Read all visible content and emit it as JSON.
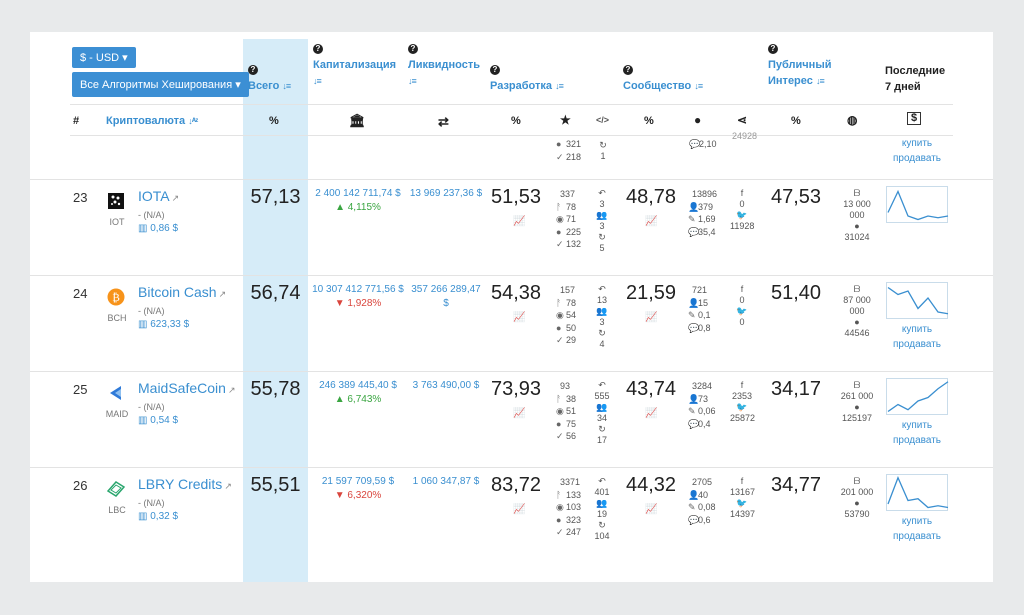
{
  "controls": {
    "currency": "$ - USD",
    "algorithms": "Все Алгоритмы Хеширования"
  },
  "headers": {
    "total": "Всего",
    "capitalization": "Капитализация",
    "liquidity": "Ликвидность",
    "development": "Разработка",
    "community": "Сообщество",
    "public_interest_1": "Публичный",
    "public_interest_2": "Интерес",
    "last7_1": "Последние",
    "last7_2": "7 дней"
  },
  "subheaders": {
    "hash": "#",
    "crypto": "Криптовалюта",
    "total_pct": "%",
    "dev_pct": "%",
    "comm_pct": "%",
    "interest_pct": "%"
  },
  "partial_top": {
    "dev_stats": [
      "321",
      "218"
    ],
    "fork_stats": [
      "1"
    ],
    "comment": "2,10",
    "interest_partial": "24928",
    "links": [
      "купить",
      "продавать"
    ]
  },
  "rows": [
    {
      "rank": "23",
      "name": "IOTA",
      "symbol": "IOT",
      "na": "- (N/A)",
      "price": "0,86 $",
      "total": "57,13",
      "cap": "2 400 142 711,74 $",
      "cap_change": "4,115%",
      "cap_dir": "up",
      "liquidity": "13 969 237,36 $",
      "dev": "51,53",
      "dev_stats": [
        "337",
        "78",
        "71",
        "225",
        "132"
      ],
      "forks": [
        "3",
        "3",
        "5"
      ],
      "community": "48,78",
      "comm_stats": [
        "13896",
        "379",
        "1,69",
        "35,4"
      ],
      "social": [
        "0",
        "11928"
      ],
      "interest": "47,53",
      "interest_stats": [
        "13 000",
        "000",
        "31024"
      ],
      "spark": [
        0.3,
        0.9,
        0.2,
        0.1,
        0.2,
        0.15,
        0.2
      ],
      "links": []
    },
    {
      "rank": "24",
      "name": "Bitcoin Cash",
      "symbol": "BCH",
      "na": "- (N/A)",
      "price": "623,33 $",
      "total": "56,74",
      "cap": "10 307 412 771,56 $",
      "cap_change": "1,928%",
      "cap_dir": "down",
      "liquidity": "357 266 289,47 $",
      "dev": "54,38",
      "dev_stats": [
        "157",
        "78",
        "54",
        "50",
        "29"
      ],
      "forks": [
        "13",
        "3",
        "4"
      ],
      "community": "21,59",
      "comm_stats": [
        "721",
        "15",
        "0,1",
        "0,8"
      ],
      "social": [
        "0",
        "0"
      ],
      "interest": "51,40",
      "interest_stats": [
        "87 000",
        "000",
        "44546"
      ],
      "spark": [
        0.9,
        0.7,
        0.8,
        0.3,
        0.6,
        0.2,
        0.15
      ],
      "links": [
        "купить",
        "продавать"
      ]
    },
    {
      "rank": "25",
      "name": "MaidSafeCoin",
      "symbol": "MAID",
      "na": "- (N/A)",
      "price": "0,54 $",
      "total": "55,78",
      "cap": "246 389 445,40 $",
      "cap_change": "6,743%",
      "cap_dir": "up",
      "liquidity": "3 763 490,00 $",
      "dev": "73,93",
      "dev_stats": [
        "93",
        "38",
        "51",
        "75",
        "56"
      ],
      "forks": [
        "555",
        "34",
        "17"
      ],
      "community": "43,74",
      "comm_stats": [
        "3284",
        "73",
        "0,06",
        "0,4"
      ],
      "social": [
        "2353",
        "25872"
      ],
      "interest": "34,17",
      "interest_stats": [
        "261 000",
        "125197"
      ],
      "spark": [
        0.1,
        0.3,
        0.15,
        0.4,
        0.5,
        0.75,
        0.95
      ],
      "links": [
        "купить",
        "продавать"
      ]
    },
    {
      "rank": "26",
      "name": "LBRY Credits",
      "symbol": "LBC",
      "na": "- (N/A)",
      "price": "0,32 $",
      "total": "55,51",
      "cap": "21 597 709,59 $",
      "cap_change": "6,320%",
      "cap_dir": "down",
      "liquidity": "1 060 347,87 $",
      "dev": "83,72",
      "dev_stats": [
        "3371",
        "133",
        "103",
        "323",
        "247"
      ],
      "forks": [
        "401",
        "19",
        "104"
      ],
      "community": "44,32",
      "comm_stats": [
        "2705",
        "40",
        "0,08",
        "0,6"
      ],
      "social": [
        "13167",
        "14397"
      ],
      "interest": "34,77",
      "interest_stats": [
        "201 000",
        "53790"
      ],
      "spark": [
        0.2,
        0.95,
        0.3,
        0.35,
        0.1,
        0.15,
        0.1
      ],
      "links": [
        "купить",
        "продавать"
      ]
    }
  ],
  "colors": {
    "accent": "#3a8fd0",
    "highlight": "#d6ecf8",
    "up": "#3aa541",
    "down": "#d9453d"
  }
}
